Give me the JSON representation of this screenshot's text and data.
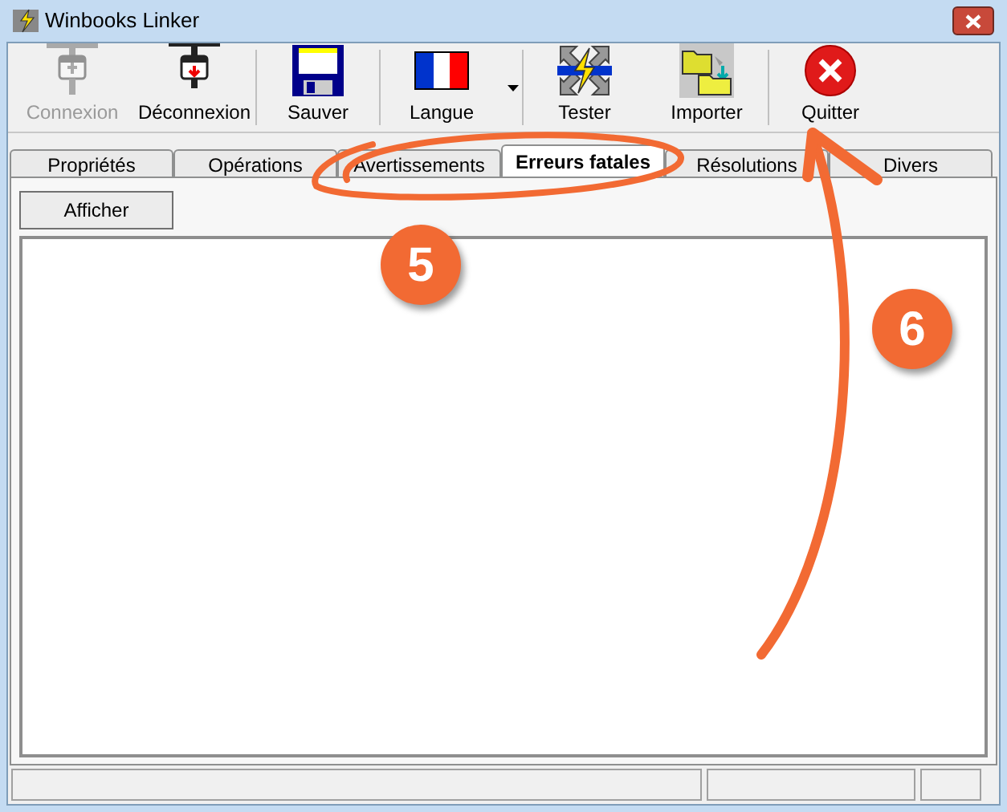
{
  "window": {
    "title": "Winbooks Linker"
  },
  "toolbar": [
    {
      "label": "Connexion",
      "disabled": true,
      "kind": "plain"
    },
    {
      "label": "Déconnexion",
      "disabled": false,
      "kind": "plain"
    },
    {
      "label": "Sauver",
      "disabled": false,
      "kind": "plain"
    },
    {
      "label": "Langue",
      "disabled": false,
      "kind": "dropdown"
    },
    {
      "label": "Tester",
      "disabled": false,
      "kind": "plain"
    },
    {
      "label": "Importer",
      "disabled": false,
      "kind": "plain"
    },
    {
      "label": "Quitter",
      "disabled": false,
      "kind": "plain"
    }
  ],
  "tabs": [
    {
      "label": "Propriétés",
      "selected": false
    },
    {
      "label": "Opérations",
      "selected": false
    },
    {
      "label": "Avertissements",
      "selected": false
    },
    {
      "label": "Erreurs fatales",
      "selected": true
    },
    {
      "label": "Résolutions",
      "selected": false
    },
    {
      "label": "Divers",
      "selected": false
    }
  ],
  "panel": {
    "button": "Afficher"
  },
  "annotations": [
    {
      "kind": "ellipse"
    },
    {
      "kind": "badge",
      "label": "5"
    },
    {
      "kind": "badge",
      "label": "6"
    },
    {
      "kind": "arrow"
    }
  ]
}
